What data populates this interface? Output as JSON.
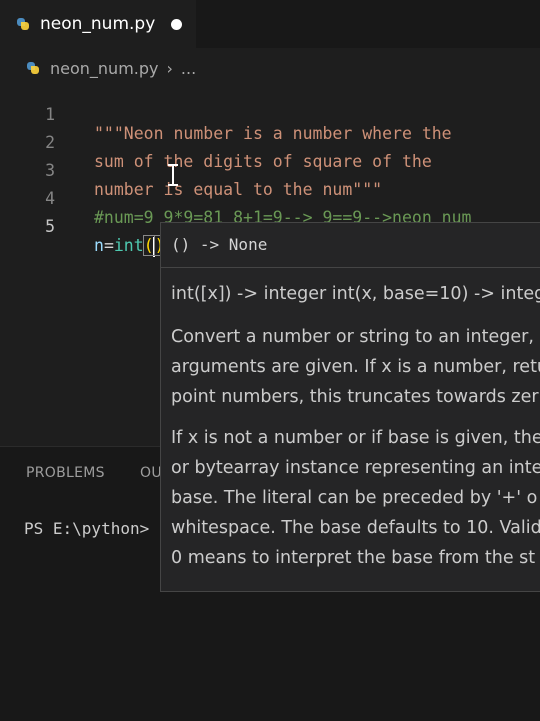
{
  "tab": {
    "title": "neon_num.py",
    "icon": "python-file-icon"
  },
  "breadcrumb": {
    "file": "neon_num.py",
    "separator": "›",
    "more": "..."
  },
  "editor": {
    "line_numbers": [
      "1",
      "2",
      "3",
      "4",
      "5"
    ],
    "line1": "\"\"\"Neon number is a number where the",
    "line2": "sum of the digits of square of the",
    "line3": "number is equal to the num\"\"\"",
    "line4": "#num=9 9*9=81 8+1=9--> 9==9-->neon num",
    "line5": {
      "var": "n",
      "op": "=",
      "fn": "int",
      "open": "(",
      "close": ")"
    }
  },
  "panel": {
    "tabs": [
      "PROBLEMS",
      "OU"
    ],
    "terminal": "PS E:\\python>"
  },
  "hover": {
    "signature": "() -> None",
    "usage": "int([x]) -> integer int(x, base=10) -> integ",
    "para1": [
      "Convert a number or string to an integer,",
      "arguments are given. If x is a number, retu",
      "point numbers, this truncates towards zer"
    ],
    "para2": [
      "If x is not a number or if base is given, the",
      "or bytearray instance representing an inte",
      "base. The literal can be preceded by '+' o",
      "whitespace. The base defaults to 10. Valid",
      "0 means to interpret the base from the st"
    ]
  },
  "colors": {
    "string": "#ce9178",
    "comment": "#6a9955",
    "function": "#4ec9b0",
    "variable": "#9cdcfe"
  }
}
